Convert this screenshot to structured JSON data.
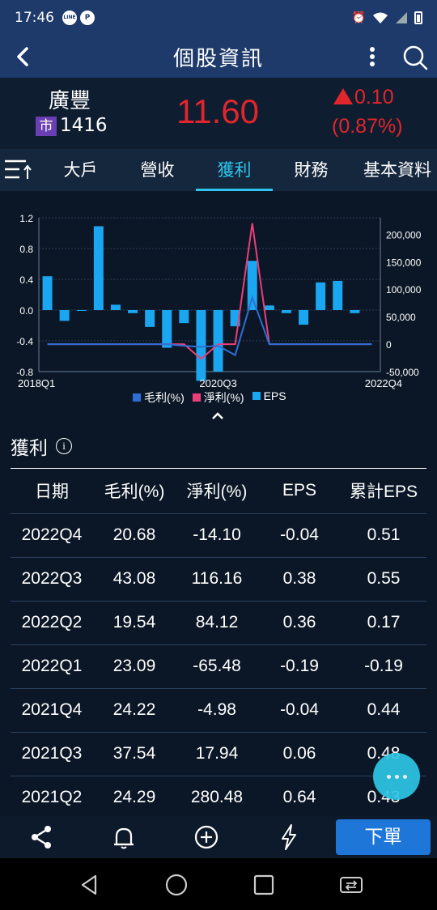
{
  "status": {
    "time": "17:46",
    "app_badge_1": "LINE",
    "app_badge_2": "P"
  },
  "appbar": {
    "title": "個股資訊"
  },
  "quote": {
    "name": "廣豐",
    "market": "市",
    "code": "1416",
    "price": "11.60",
    "change": "0.10",
    "change_pct": "(0.87%)",
    "color_down_up": "#e0262b"
  },
  "tabs": [
    {
      "label": "大戶"
    },
    {
      "label": "營收"
    },
    {
      "label": "獲利"
    },
    {
      "label": "財務"
    },
    {
      "label": "基本資料"
    }
  ],
  "active_tab": "獲利",
  "chart_data": {
    "type": "bar",
    "categories": [
      "2018Q1",
      "2018Q2",
      "2018Q3",
      "2018Q4",
      "2019Q1",
      "2019Q2",
      "2019Q3",
      "2019Q4",
      "2020Q1",
      "2020Q2",
      "2020Q3",
      "2020Q4",
      "2021Q1",
      "2021Q2",
      "2021Q3",
      "2021Q4",
      "2022Q1",
      "2022Q2",
      "2022Q3",
      "2022Q4"
    ],
    "x_tick_labels": [
      "2018Q1",
      "2020Q3",
      "2022Q4"
    ],
    "left_axis": {
      "ticks": [
        "1.2",
        "0.8",
        "0.4",
        "0.0",
        "-0.4",
        "-0.8"
      ],
      "ylim": [
        -0.8,
        1.2
      ]
    },
    "right_axis": {
      "ticks": [
        "200,000",
        "150,000",
        "100,000",
        "50,000",
        "0",
        "-50,000"
      ],
      "ylim": [
        -50000,
        230000
      ]
    },
    "series": [
      {
        "name": "毛利(%)",
        "axis": "right",
        "color": "#2d6fd6",
        "values": [
          0,
          0,
          0,
          0,
          0,
          0,
          0,
          0,
          -3000,
          -5000,
          -3000,
          -20000,
          85000,
          0,
          0,
          0,
          0,
          0,
          0,
          0
        ]
      },
      {
        "name": "淨利(%)",
        "axis": "right",
        "color": "#ec3f7a",
        "values": [
          0,
          0,
          0,
          0,
          0,
          0,
          0,
          0,
          0,
          -27000,
          0,
          0,
          220000,
          0,
          0,
          0,
          0,
          0,
          0,
          0
        ]
      },
      {
        "name": "EPS",
        "axis": "left",
        "color": "#1aa6f0",
        "values": [
          0.44,
          -0.14,
          -0.01,
          1.09,
          0.07,
          -0.04,
          -0.22,
          -0.49,
          -0.17,
          -0.92,
          -0.8,
          -0.21,
          0.64,
          0.06,
          -0.04,
          -0.19,
          0.36,
          0.38,
          -0.04,
          0
        ]
      }
    ],
    "legend": [
      "毛利(%)",
      "淨利(%)",
      "EPS"
    ],
    "grid": true
  },
  "section": {
    "title": "獲利",
    "info": "i"
  },
  "table": {
    "headers": [
      "日期",
      "毛利(%)",
      "淨利(%)",
      "EPS",
      "累計EPS"
    ],
    "rows": [
      [
        "2022Q4",
        "20.68",
        "-14.10",
        "-0.04",
        "0.51"
      ],
      [
        "2022Q3",
        "43.08",
        "116.16",
        "0.38",
        "0.55"
      ],
      [
        "2022Q2",
        "19.54",
        "84.12",
        "0.36",
        "0.17"
      ],
      [
        "2022Q1",
        "23.09",
        "-65.48",
        "-0.19",
        "-0.19"
      ],
      [
        "2021Q4",
        "24.22",
        "-4.98",
        "-0.04",
        "0.44"
      ],
      [
        "2021Q3",
        "37.54",
        "17.94",
        "0.06",
        "0.48"
      ],
      [
        "2021Q2",
        "24.29",
        "280.48",
        "0.64",
        "0.43"
      ]
    ]
  },
  "bottom": {
    "order_label": "下單"
  }
}
